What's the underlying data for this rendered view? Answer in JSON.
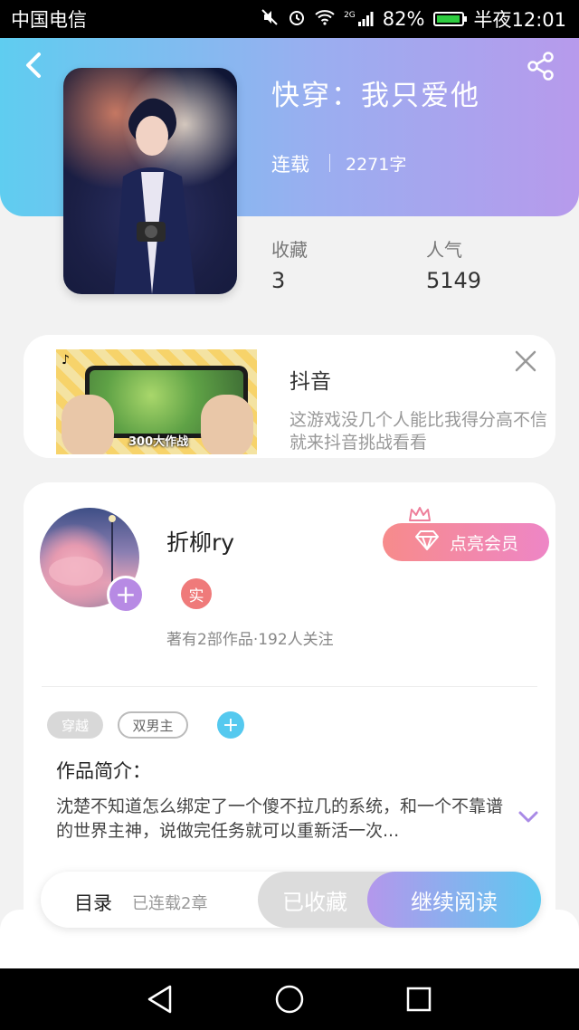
{
  "status_bar": {
    "carrier": "中国电信",
    "network": "2G",
    "battery": "82%",
    "time": "半夜12:01"
  },
  "book": {
    "title": "快穿：我只爱他",
    "status": "连载",
    "word_count": "2271字",
    "favorites_label": "收藏",
    "favorites_value": "3",
    "popularity_label": "人气",
    "popularity_value": "5149"
  },
  "ad": {
    "title": "抖音",
    "description": "这游戏没几个人能比我得分高不信就来抖音挑战看看",
    "image_caption": "300大作战"
  },
  "author": {
    "name": "折柳ry",
    "verify_badge": "实",
    "stats": "著有2部作品·192人关注",
    "vip_button": "点亮会员"
  },
  "tags": [
    {
      "label": "穿越",
      "style": "filled"
    },
    {
      "label": "双男主",
      "style": "outline"
    }
  ],
  "intro": {
    "label": "作品简介：",
    "text": "沈楚不知道怎么绑定了一个傻不拉几的系统，和一个不靠谱的世界主神，说做完任务就可以重新活一次..."
  },
  "actions": {
    "toc_label": "目录",
    "toc_count": "已连载2章",
    "collected_label": "已收藏",
    "read_label": "继续阅读"
  },
  "icons": {
    "back": "back-chevron-icon",
    "share": "share-icon",
    "close": "close-icon",
    "expand": "chevron-down-icon",
    "crown": "crown-icon",
    "diamond": "diamond-icon"
  },
  "colors": {
    "header_gradient_start": "#5fcdf0",
    "header_gradient_end": "#b79aec",
    "vip_pink": "#f78b8b",
    "read_gradient_start": "#b497ec",
    "read_gradient_end": "#5dc9f0",
    "badge_red": "#ef7a7a",
    "tag_add_blue": "#55c9ef"
  }
}
